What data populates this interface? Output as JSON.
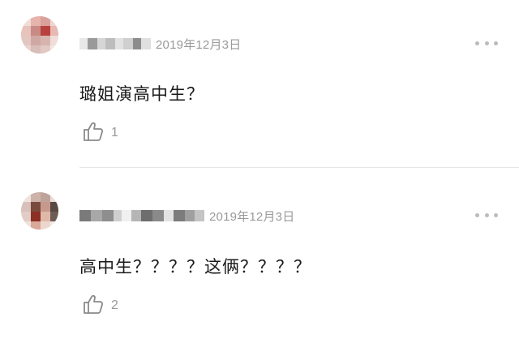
{
  "comments": [
    {
      "date": "2019年12月3日",
      "text": "璐姐演高中生？",
      "likes": "1",
      "like_icon": "thumbs-up-icon",
      "more_icon": "more-dots-icon"
    },
    {
      "date": "2019年12月3日",
      "text": "高中生？？？？这俩？？？？",
      "likes": "2",
      "like_icon": "thumbs-up-icon",
      "more_icon": "more-dots-icon"
    }
  ],
  "colors": {
    "text": "#1a1a1a",
    "meta": "#9a9a9a",
    "divider": "#e6e6e6"
  }
}
